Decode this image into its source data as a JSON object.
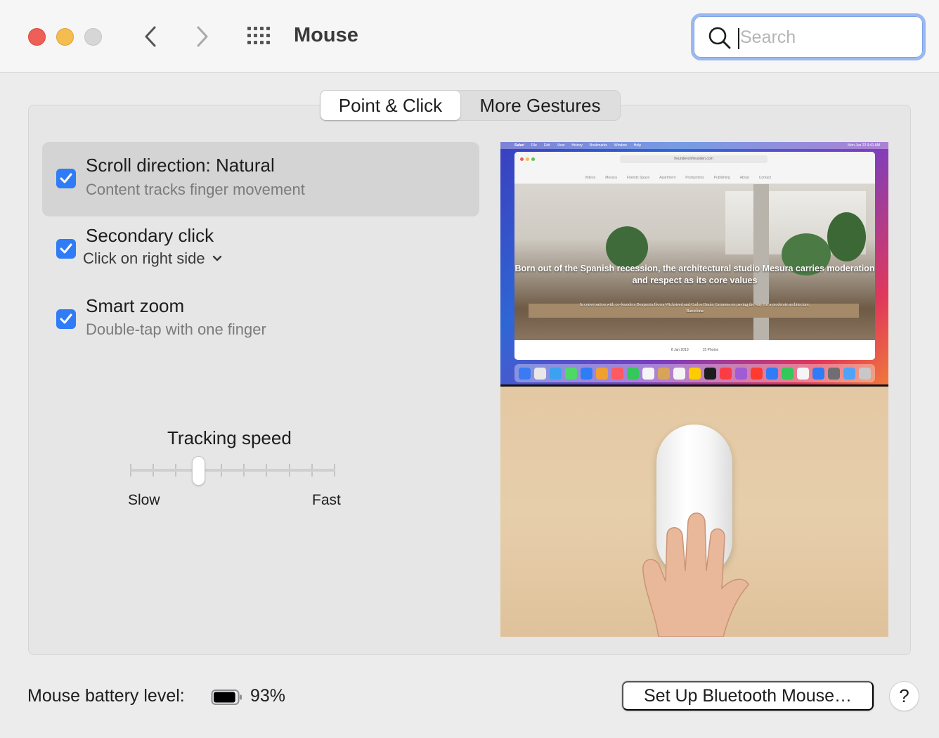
{
  "window": {
    "title": "Mouse"
  },
  "search": {
    "placeholder": "Search"
  },
  "tabs": [
    {
      "label": "Point & Click",
      "active": true
    },
    {
      "label": "More Gestures",
      "active": false
    }
  ],
  "options": [
    {
      "title": "Scroll direction: Natural",
      "subtitle": "Content tracks finger movement",
      "checked": true,
      "selected": true
    },
    {
      "title": "Secondary click",
      "popup_value": "Click on right side",
      "checked": true,
      "selected": false
    },
    {
      "title": "Smart zoom",
      "subtitle": "Double-tap with one finger",
      "checked": true,
      "selected": false
    }
  ],
  "tracking": {
    "label": "Tracking speed",
    "min_label": "Slow",
    "max_label": "Fast",
    "tick_count": 10,
    "value_step": 3
  },
  "preview": {
    "menubar": [
      "Safari",
      "File",
      "Edit",
      "View",
      "History",
      "Bookmarks",
      "Window",
      "Help"
    ],
    "clock": "Mon Jun 22  9:41 AM",
    "url": "freundevonfreunden.com",
    "site_nav": [
      "Videos",
      "Mesura",
      "Friends Space",
      "Apartment",
      "Productions",
      "Publishing",
      "About",
      "Contact"
    ],
    "headline": "Born out of the Spanish recession, the architectural studio Mesura carries moderation and respect as its core values",
    "subheadline": "In conversation with co-founders Benjamin Iborra Wicksteed and Carlos Durán Carmona on paving the way for a moderate architecture, Barcelona",
    "footer_date": "8 Jan 2019",
    "footer_photos": "15 Photos"
  },
  "footer": {
    "battery_label": "Mouse battery level:",
    "battery_percent": "93%",
    "battery_fraction": 0.93,
    "bluetooth_button": "Set Up Bluetooth Mouse…",
    "help_label": "?"
  },
  "colors": {
    "accent": "#2f7cf6",
    "close": "#ee5f57",
    "minimize": "#f5bd4f",
    "zoom_disabled": "#d6d6d6"
  },
  "icons": [
    "back-chevron-icon",
    "forward-chevron-icon",
    "show-all-grid-icon",
    "search-icon",
    "checkmark-icon",
    "chevron-down-icon",
    "battery-icon"
  ]
}
